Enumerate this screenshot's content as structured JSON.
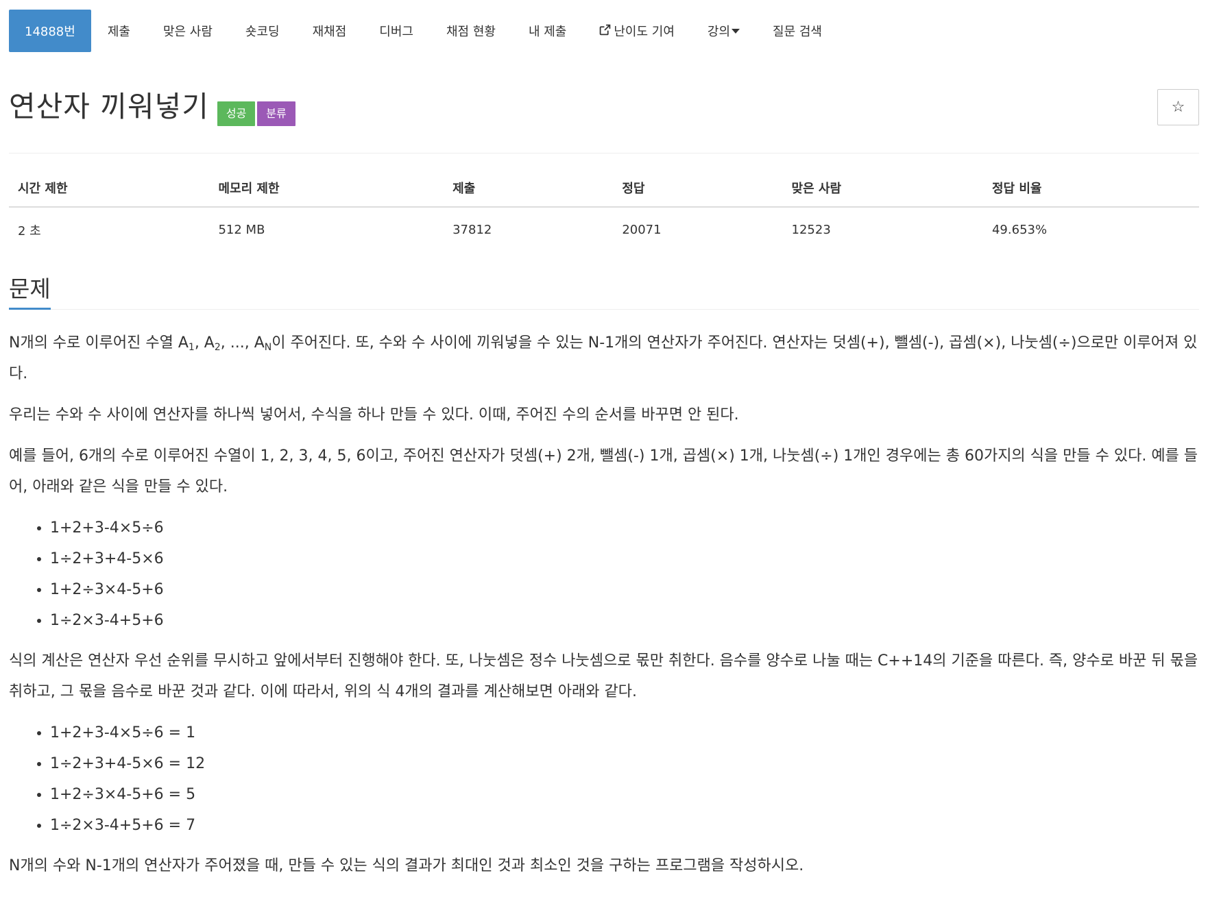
{
  "nav": {
    "items": [
      {
        "label": "14888번",
        "active": true
      },
      {
        "label": "제출"
      },
      {
        "label": "맞은 사람"
      },
      {
        "label": "숏코딩"
      },
      {
        "label": "재채점"
      },
      {
        "label": "디버그"
      },
      {
        "label": "채점 현황"
      },
      {
        "label": "내 제출"
      },
      {
        "label": "난이도 기여",
        "icon": "external-link-icon"
      },
      {
        "label": "강의",
        "icon": "caret-down-icon"
      },
      {
        "label": "질문 검색"
      }
    ]
  },
  "problem": {
    "title": "연산자 끼워넣기",
    "badges": {
      "success": "성공",
      "category": "분류"
    },
    "star_icon": "☆"
  },
  "info": {
    "headers": [
      "시간 제한",
      "메모리 제한",
      "제출",
      "정답",
      "맞은 사람",
      "정답 비율"
    ],
    "values": [
      "2 초",
      "512 MB",
      "37812",
      "20071",
      "12523",
      "49.653%"
    ]
  },
  "section": {
    "title": "문제"
  },
  "description": {
    "p1_a": "N개의 수로 이루어진 수열 A",
    "p1_sub1": "1",
    "p1_b": ", A",
    "p1_sub2": "2",
    "p1_c": ", ..., A",
    "p1_subN": "N",
    "p1_d": "이 주어진다. 또, 수와 수 사이에 끼워넣을 수 있는 N-1개의 연산자가 주어진다. 연산자는 덧셈(+), 뺄셈(-), 곱셈(×), 나눗셈(÷)으로만 이루어져 있다.",
    "p2": "우리는 수와 수 사이에 연산자를 하나씩 넣어서, 수식을 하나 만들 수 있다. 이때, 주어진 수의 순서를 바꾸면 안 된다.",
    "p3": "예를 들어, 6개의 수로 이루어진 수열이 1, 2, 3, 4, 5, 6이고, 주어진 연산자가 덧셈(+) 2개, 뺄셈(-) 1개, 곱셈(×) 1개, 나눗셈(÷) 1개인 경우에는 총 60가지의 식을 만들 수 있다. 예를 들어, 아래와 같은 식을 만들 수 있다.",
    "list1": [
      "1+2+3-4×5÷6",
      "1÷2+3+4-5×6",
      "1+2÷3×4-5+6",
      "1÷2×3-4+5+6"
    ],
    "p4": "식의 계산은 연산자 우선 순위를 무시하고 앞에서부터 진행해야 한다. 또, 나눗셈은 정수 나눗셈으로 몫만 취한다. 음수를 양수로 나눌 때는 C++14의 기준을 따른다. 즉, 양수로 바꾼 뒤 몫을 취하고, 그 몫을 음수로 바꾼 것과 같다. 이에 따라서, 위의 식 4개의 결과를 계산해보면 아래와 같다.",
    "list2": [
      "1+2+3-4×5÷6 = 1",
      "1÷2+3+4-5×6 = 12",
      "1+2÷3×4-5+6 = 5",
      "1÷2×3-4+5+6 = 7"
    ],
    "p5": "N개의 수와 N-1개의 연산자가 주어졌을 때, 만들 수 있는 식의 결과가 최대인 것과 최소인 것을 구하는 프로그램을 작성하시오."
  },
  "colors": {
    "primary": "#428bca",
    "success": "#5cb85c",
    "category": "#9b59b6"
  }
}
